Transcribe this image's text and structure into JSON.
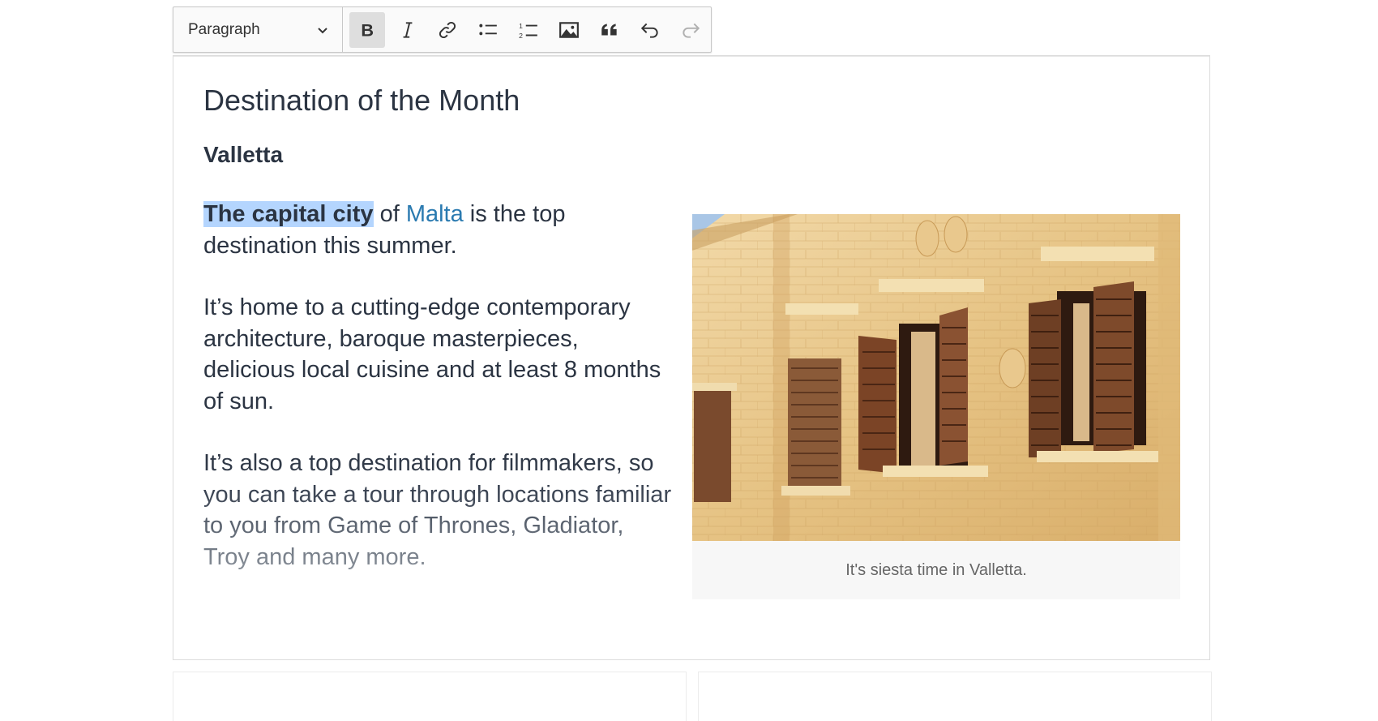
{
  "toolbar": {
    "heading_select": {
      "value": "Paragraph"
    },
    "buttons": [
      {
        "name": "bold-button",
        "icon": "bold-icon",
        "active": true
      },
      {
        "name": "italic-button",
        "icon": "italic-icon",
        "active": false
      },
      {
        "name": "link-button",
        "icon": "link-icon",
        "active": false
      },
      {
        "name": "bulleted-list-button",
        "icon": "bulleted-list-icon",
        "active": false
      },
      {
        "name": "numbered-list-button",
        "icon": "numbered-list-icon",
        "active": false
      },
      {
        "name": "insert-image-button",
        "icon": "image-icon",
        "active": false
      },
      {
        "name": "block-quote-button",
        "icon": "quote-icon",
        "active": false
      },
      {
        "name": "undo-button",
        "icon": "undo-icon",
        "active": false
      },
      {
        "name": "redo-button",
        "icon": "redo-icon",
        "active": false
      }
    ]
  },
  "document": {
    "title": "Destination of the Month",
    "subtitle": "Valletta",
    "paragraph1": {
      "selected": "The capital city",
      "text_a": " of ",
      "link": "Malta",
      "text_b": " is the top destination this summer."
    },
    "paragraph2": "It’s home to a cutting-edge contemporary architecture, baroque masterpieces, delicious local cuisine and at least 8 months of sun.",
    "paragraph3": "It’s also a top destination for filmmakers, so you can take a tour through locations familiar to you from Game of Thrones, Gladiator, Troy and many more.",
    "figure": {
      "caption": "It's siesta time in Valletta."
    }
  },
  "colors": {
    "text": "#2b3442",
    "link": "#2a7ab0",
    "selection": "#b4d5fe",
    "toolbar_bg": "#fafafa",
    "active_button": "#dedede"
  }
}
